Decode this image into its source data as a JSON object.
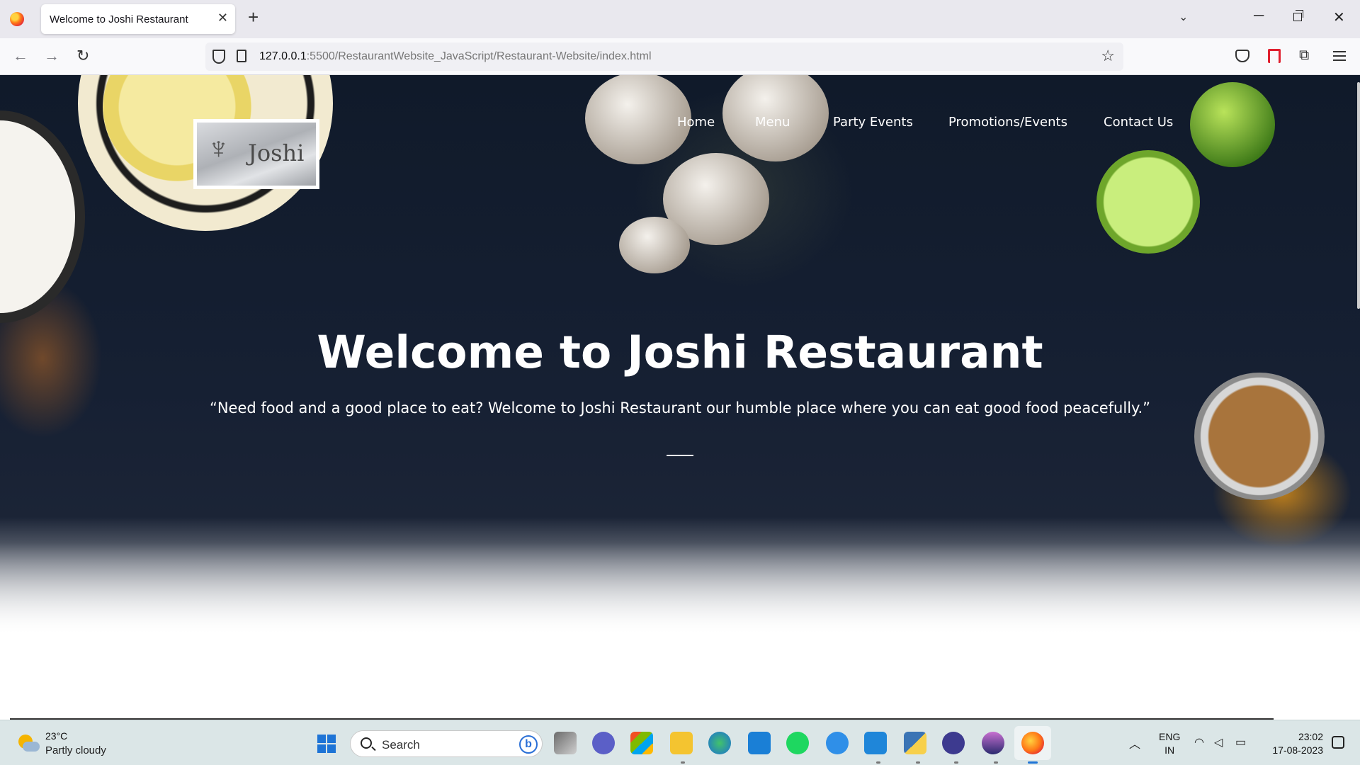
{
  "browser": {
    "tab_title": "Welcome to Joshi Restaurant",
    "tab_close": "✕",
    "new_tab": "+",
    "url_host": "127.0.0.1",
    "url_path": ":5500/RestaurantWebsite_JavaScript/Restaurant-Website/index.html"
  },
  "site": {
    "logo_text": "Joshi",
    "nav": [
      "Home",
      "Menu",
      "Party Events",
      "Promotions/Events",
      "Contact Us"
    ],
    "hero_title": "Welcome to Joshi Restaurant",
    "hero_subtitle": "“Need food and a good place to eat? Welcome to Joshi Restaurant our humble place where you can eat good food peacefully.”"
  },
  "taskbar": {
    "temperature": "23°C",
    "weather": "Partly cloudy",
    "search_label": "Search",
    "language": "ENG",
    "region": "IN",
    "time": "23:02",
    "date": "17-08-2023",
    "apps": [
      "task-view",
      "teams-chat",
      "microsoft-store",
      "file-explorer",
      "edge",
      "myhp",
      "spotify",
      "help",
      "vscode",
      "python",
      "copilot",
      "media",
      "firefox"
    ]
  },
  "colors": {
    "hero_background": "#162033",
    "accent_lime": "#6ea62b",
    "spice": "#d68c18",
    "windows_blue": "#1e74d6"
  }
}
